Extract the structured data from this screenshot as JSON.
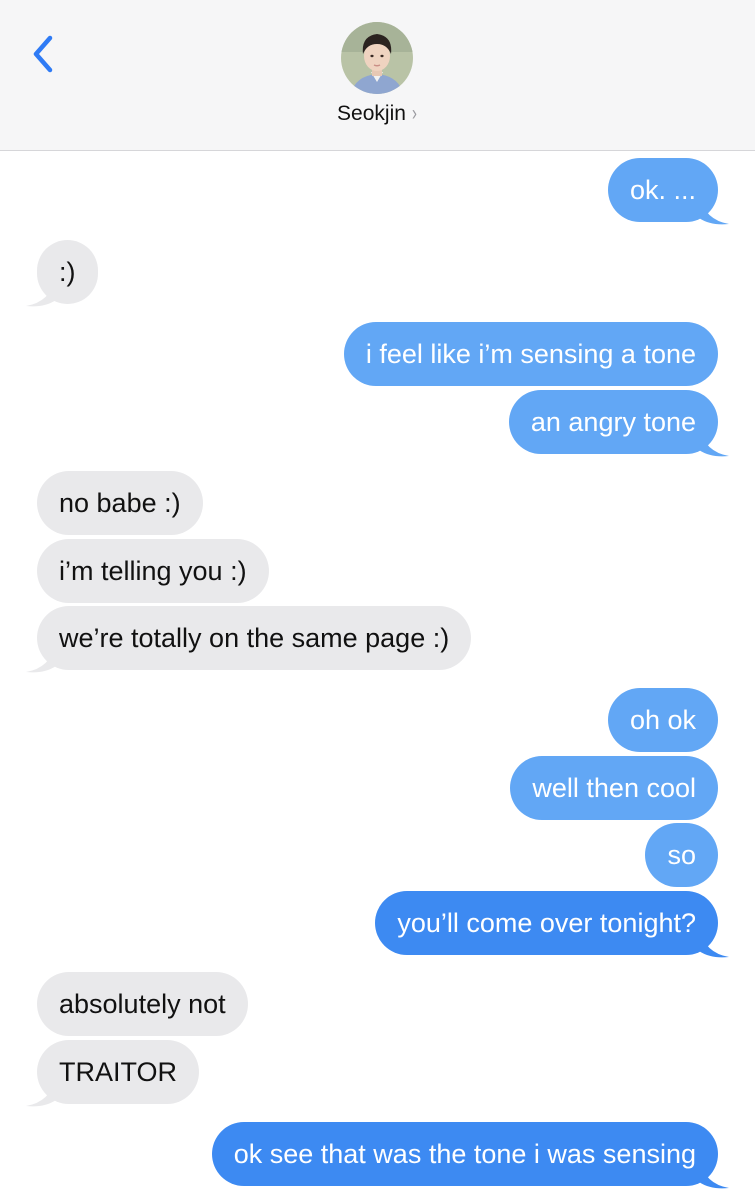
{
  "header": {
    "contact_name": "Seokjin",
    "chevron": "›",
    "back_icon": "chevron-left-icon",
    "accent_color": "#2f7bf5"
  },
  "colors": {
    "sent_bubble_light": "#62a7f5",
    "sent_bubble_dark": "#3d8af2",
    "received_bubble": "#e9e9eb"
  },
  "messages": [
    {
      "from": "me",
      "text": "ok. ..."
    },
    {
      "from": "them",
      "text": ":)"
    },
    {
      "from": "me",
      "text": "i feel like i’m sensing a tone"
    },
    {
      "from": "me",
      "text": "an angry tone"
    },
    {
      "from": "them",
      "text": "no babe :)"
    },
    {
      "from": "them",
      "text": "i’m telling you :)"
    },
    {
      "from": "them",
      "text": "we’re totally on the same page :)"
    },
    {
      "from": "me",
      "text": "oh ok"
    },
    {
      "from": "me",
      "text": "well then cool"
    },
    {
      "from": "me",
      "text": "so"
    },
    {
      "from": "me",
      "text": "you’ll come over tonight?"
    },
    {
      "from": "them",
      "text": "absolutely not"
    },
    {
      "from": "them",
      "text": "TRAITOR"
    },
    {
      "from": "me",
      "text": "ok see that was the tone i was sensing"
    }
  ]
}
